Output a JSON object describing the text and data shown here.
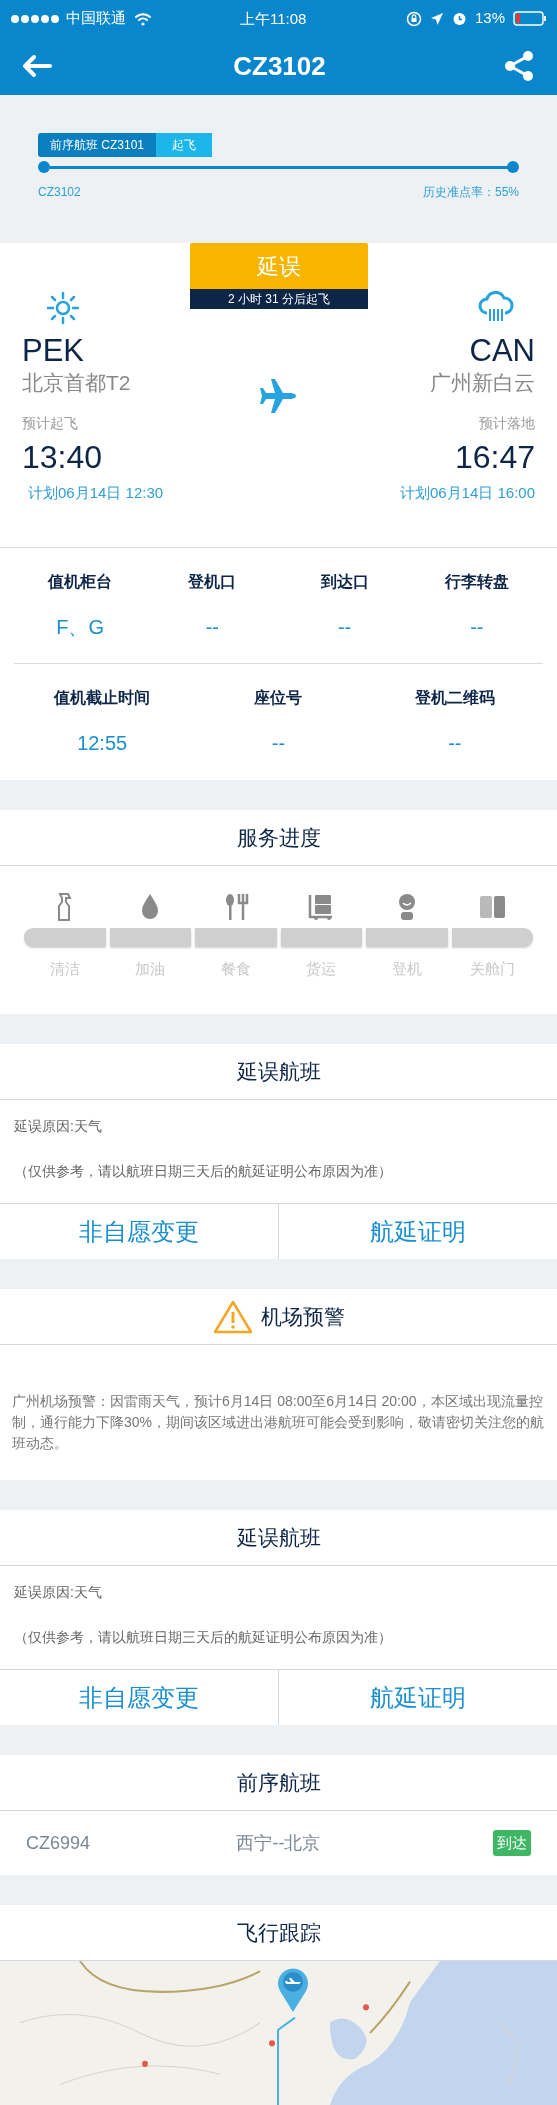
{
  "status_bar": {
    "carrier": "中国联通",
    "time": "上午11:08",
    "battery": "13%"
  },
  "header": {
    "title": "CZ3102"
  },
  "progress": {
    "previous_flight": "前序航班 CZ3101",
    "previous_status": "起飞",
    "flight": "CZ3102",
    "on_time_rate": "历史准点率：55%"
  },
  "flight": {
    "status": "延误",
    "countdown": "2 小时 31 分后起飞",
    "departure": {
      "weather": {
        "kind": "sunny"
      },
      "code": "PEK",
      "airport": "北京首都T2",
      "time_label": "预计起飞",
      "time": "13:40",
      "scheduled": "计划06月14日 12:30"
    },
    "arrival": {
      "weather": {
        "kind": "rain"
      },
      "code": "CAN",
      "airport": "广州新白云",
      "time_label": "预计落地",
      "time": "16:47",
      "scheduled": "计划06月14日 16:00"
    }
  },
  "info_rows": [
    [
      {
        "label": "值机柜台",
        "value": "F、G"
      },
      {
        "label": "登机口",
        "value": "--"
      },
      {
        "label": "到达口",
        "value": "--"
      },
      {
        "label": "行李转盘",
        "value": "--"
      }
    ],
    [
      {
        "label": "值机截止时间",
        "value": "12:55"
      },
      {
        "label": "座位号",
        "value": "--"
      },
      {
        "label": "登机二维码",
        "value": "--"
      }
    ]
  ],
  "service_progress": {
    "title": "服务进度",
    "steps": [
      {
        "kind": "cleaning",
        "label": "清洁",
        "done": false
      },
      {
        "kind": "fuel",
        "label": "加油",
        "done": false
      },
      {
        "kind": "meal",
        "label": "餐食",
        "done": false
      },
      {
        "kind": "cargo",
        "label": "货运",
        "done": false
      },
      {
        "kind": "boarding",
        "label": "登机",
        "done": false
      },
      {
        "kind": "door",
        "label": "关舱门",
        "done": false
      }
    ]
  },
  "sections": [
    {
      "kind": "delay",
      "title": "延误航班",
      "reason": "延误原因:天气",
      "note": "（仅供参考，请以航班日期三天后的航延证明公布原因为准）",
      "buttons": [
        "非自愿变更",
        "航延证明"
      ]
    },
    {
      "kind": "alert",
      "title": "机场预警",
      "text": "广州机场预警：因雷雨天气，预计6月14日 08:00至6月14日 20:00，本区域出现流量控制，通行能力下降30%，期间该区域进出港航班可能会受到影响，敬请密切关注您的航班动态。"
    },
    {
      "kind": "delay",
      "title": "延误航班",
      "reason": "延误原因:天气",
      "note": "（仅供参考，请以航班日期三天后的航延证明公布原因为准）",
      "buttons": [
        "非自愿变更",
        "航延证明"
      ]
    },
    {
      "kind": "previous",
      "title": "前序航班",
      "flight": "CZ6994",
      "route": "西宁--北京",
      "status": "到达"
    },
    {
      "kind": "tracking",
      "title": "飞行跟踪"
    }
  ]
}
